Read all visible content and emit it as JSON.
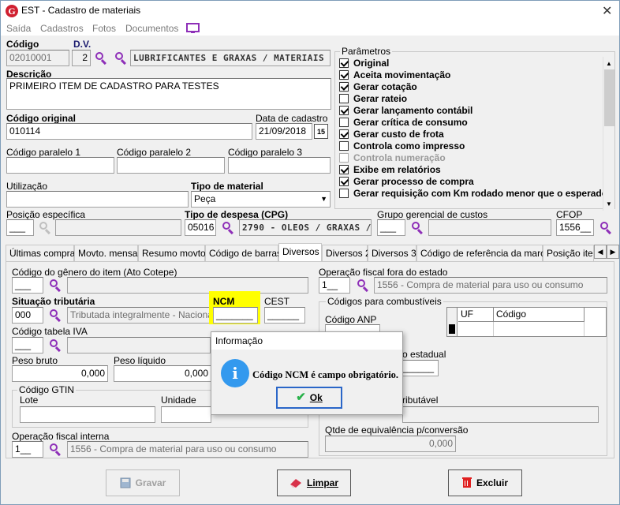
{
  "window": {
    "title": "EST - Cadastro de materiais",
    "logo_letter": "G"
  },
  "menu": {
    "items": [
      "Saída",
      "Cadastros",
      "Fotos",
      "Documentos"
    ]
  },
  "main": {
    "codigo_label": "Código",
    "codigo_value": "02010001",
    "dv_label": "D.V.",
    "dv_value": "2",
    "grupo_value": "LUBRIFICANTES E GRAXAS / MATERIAIS",
    "descricao_label": "Descrição",
    "descricao_value": "PRIMEIRO ITEM DE CADASTRO PARA TESTES",
    "codigo_original_label": "Código original",
    "codigo_original_value": "010114",
    "data_cadastro_label": "Data de cadastro",
    "data_cadastro_value": "21/09/2018",
    "calendar_label": "15",
    "codigo_paralelo_1_label": "Código paralelo 1",
    "codigo_paralelo_2_label": "Código paralelo 2",
    "codigo_paralelo_3_label": "Código paralelo 3",
    "utilizacao_label": "Utilização",
    "tipo_material_label": "Tipo de material",
    "tipo_material_value": "Peça",
    "posicao_especifica_label": "Posição específica",
    "tipo_despesa_label": "Tipo de despesa (CPG)",
    "tipo_despesa_code": "05016",
    "tipo_despesa_desc": "2790 - OLEOS / GRAXAS / L",
    "grupo_gerencial_label": "Grupo gerencial de custos",
    "cfop_label": "CFOP",
    "cfop_value": "1556"
  },
  "parametros": {
    "title": "Parâmetros",
    "items": [
      {
        "label": "Original",
        "checked": true,
        "enabled": true
      },
      {
        "label": "Aceita movimentação",
        "checked": true,
        "enabled": true
      },
      {
        "label": "Gerar cotação",
        "checked": true,
        "enabled": true
      },
      {
        "label": "Gerar rateio",
        "checked": false,
        "enabled": true
      },
      {
        "label": "Gerar lançamento contábil",
        "checked": true,
        "enabled": true
      },
      {
        "label": "Gerar crítica de consumo",
        "checked": false,
        "enabled": true
      },
      {
        "label": "Gerar custo de frota",
        "checked": true,
        "enabled": true
      },
      {
        "label": "Controla como impresso",
        "checked": false,
        "enabled": true
      },
      {
        "label": "Controla numeração",
        "checked": false,
        "enabled": false
      },
      {
        "label": "Exibe em relatórios",
        "checked": true,
        "enabled": true
      },
      {
        "label": "Gerar processo de compra",
        "checked": true,
        "enabled": true
      },
      {
        "label": "Gerar requisição com Km rodado menor que o esperado",
        "checked": false,
        "enabled": true
      }
    ]
  },
  "tabs": [
    {
      "label": "Últimas compras",
      "active": false
    },
    {
      "label": "Movto. mensal",
      "active": false
    },
    {
      "label": "Resumo movto.",
      "active": false
    },
    {
      "label": "Código de barras",
      "active": false
    },
    {
      "label": "Diversos",
      "active": true
    },
    {
      "label": "Diversos 2",
      "active": false
    },
    {
      "label": "Diversos 3",
      "active": false
    },
    {
      "label": "Código de referência da marca",
      "active": false
    },
    {
      "label": "Posição item",
      "active": false
    }
  ],
  "diversos": {
    "genero_label": "Código do gênero do item (Ato Cotepe)",
    "situacao_label": "Situação tributária",
    "situacao_code": "000",
    "situacao_desc": "Tributada integralmente - Nacional",
    "ncm_label": "NCM",
    "cest_label": "CEST",
    "tabela_iva_label": "Código tabela IVA",
    "peso_bruto_label": "Peso bruto",
    "peso_bruto_value": "0,000",
    "peso_liquido_label": "Peso líquido",
    "peso_liquido_value": "0,000",
    "gtin_title": "Código GTIN",
    "lote_label": "Lote",
    "unidade_label": "Unidade",
    "op_interna_label": "Operação fiscal interna",
    "op_interna_code": "1",
    "op_interna_desc": "1556 - Compra de material para uso ou consumo",
    "op_fora_label": "Operação fiscal fora do estado",
    "op_fora_code": "1",
    "op_fora_desc": "1556 - Compra de material para uso ou consumo",
    "combustiveis_title": "Códigos para combustíveis",
    "anp_label": "Código ANP",
    "estadual_label": "o estadual",
    "grid_col_uf": "UF",
    "grid_col_codigo": "Código",
    "tributavel_label": "ributável",
    "qtde_label": "Qtde de equivalência p/conversão",
    "qtde_value": "0,000"
  },
  "buttons": {
    "gravar": "Gravar",
    "limpar": "Limpar",
    "excluir": "Excluir"
  },
  "dialog": {
    "title": "Informação",
    "icon": "i",
    "message": "Código NCM é campo obrigatório.",
    "ok": "Ok"
  }
}
